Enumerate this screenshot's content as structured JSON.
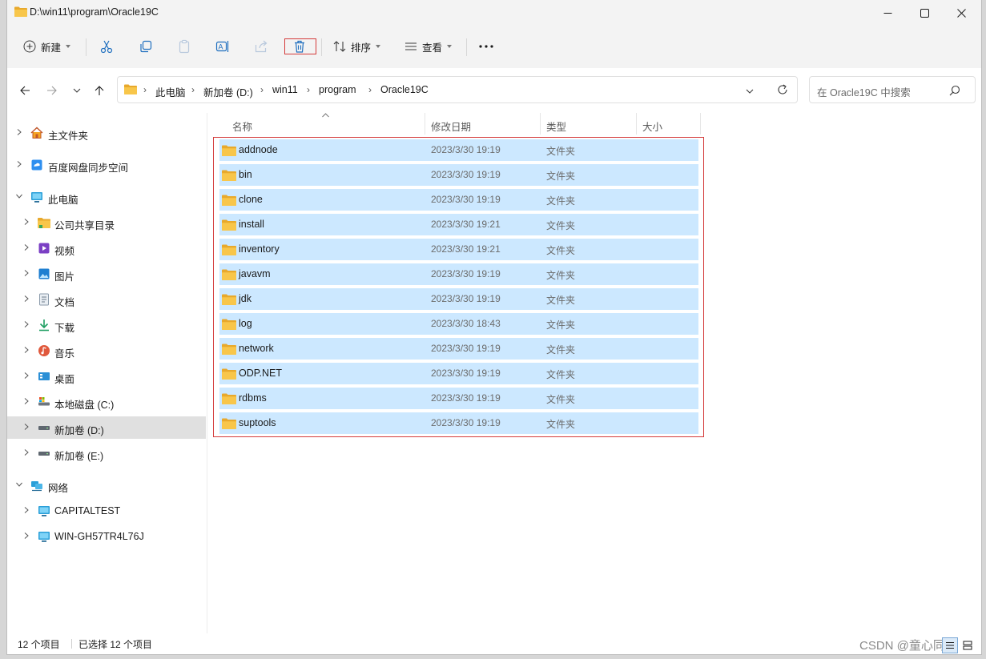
{
  "window": {
    "title": "D:\\win11\\program\\Oracle19C"
  },
  "toolbar": {
    "new_label": "新建",
    "sort_label": "排序",
    "view_label": "查看"
  },
  "breadcrumb": [
    "此电脑",
    "新加卷 (D:)",
    "win11",
    "program",
    "Oracle19C"
  ],
  "search": {
    "placeholder": "在 Oracle19C 中搜索"
  },
  "sidebar": {
    "items": [
      {
        "label": "主文件夹",
        "icon": "home-icon"
      },
      {
        "label": "百度网盘同步空间",
        "icon": "cloud-sync-icon"
      },
      {
        "label": "此电脑",
        "icon": "computer-icon"
      },
      {
        "label": "公司共享目录",
        "icon": "folder-icon"
      },
      {
        "label": "视频",
        "icon": "video-icon"
      },
      {
        "label": "图片",
        "icon": "picture-icon"
      },
      {
        "label": "文档",
        "icon": "document-icon"
      },
      {
        "label": "下载",
        "icon": "download-icon"
      },
      {
        "label": "音乐",
        "icon": "music-icon"
      },
      {
        "label": "桌面",
        "icon": "desktop-icon"
      },
      {
        "label": "本地磁盘 (C:)",
        "icon": "drive-icon"
      },
      {
        "label": "新加卷 (D:)",
        "icon": "drive-icon"
      },
      {
        "label": "新加卷 (E:)",
        "icon": "drive-icon"
      },
      {
        "label": "网络",
        "icon": "network-icon"
      },
      {
        "label": "CAPITALTEST",
        "icon": "monitor-icon"
      },
      {
        "label": "WIN-GH57TR4L76J",
        "icon": "monitor-icon"
      }
    ],
    "selected": "新加卷 (D:)"
  },
  "columns": {
    "name": "名称",
    "modified": "修改日期",
    "type": "类型",
    "size": "大小"
  },
  "files": [
    {
      "name": "addnode",
      "modified": "2023/3/30 19:19",
      "type": "文件夹"
    },
    {
      "name": "bin",
      "modified": "2023/3/30 19:19",
      "type": "文件夹"
    },
    {
      "name": "clone",
      "modified": "2023/3/30 19:19",
      "type": "文件夹"
    },
    {
      "name": "install",
      "modified": "2023/3/30 19:21",
      "type": "文件夹"
    },
    {
      "name": "inventory",
      "modified": "2023/3/30 19:21",
      "type": "文件夹"
    },
    {
      "name": "javavm",
      "modified": "2023/3/30 19:19",
      "type": "文件夹"
    },
    {
      "name": "jdk",
      "modified": "2023/3/30 19:19",
      "type": "文件夹"
    },
    {
      "name": "log",
      "modified": "2023/3/30 18:43",
      "type": "文件夹"
    },
    {
      "name": "network",
      "modified": "2023/3/30 19:19",
      "type": "文件夹"
    },
    {
      "name": "ODP.NET",
      "modified": "2023/3/30 19:19",
      "type": "文件夹"
    },
    {
      "name": "rdbms",
      "modified": "2023/3/30 19:19",
      "type": "文件夹"
    },
    {
      "name": "suptools",
      "modified": "2023/3/30 19:19",
      "type": "文件夹"
    }
  ],
  "status": {
    "item_count": "12 个项目",
    "selected_count": "已选择 12 个项目"
  },
  "watermark": "CSDN @童心同萌",
  "colors": {
    "selection": "#cce8ff",
    "highlight_box": "#d43b3b",
    "folder": "#f8c64a"
  }
}
